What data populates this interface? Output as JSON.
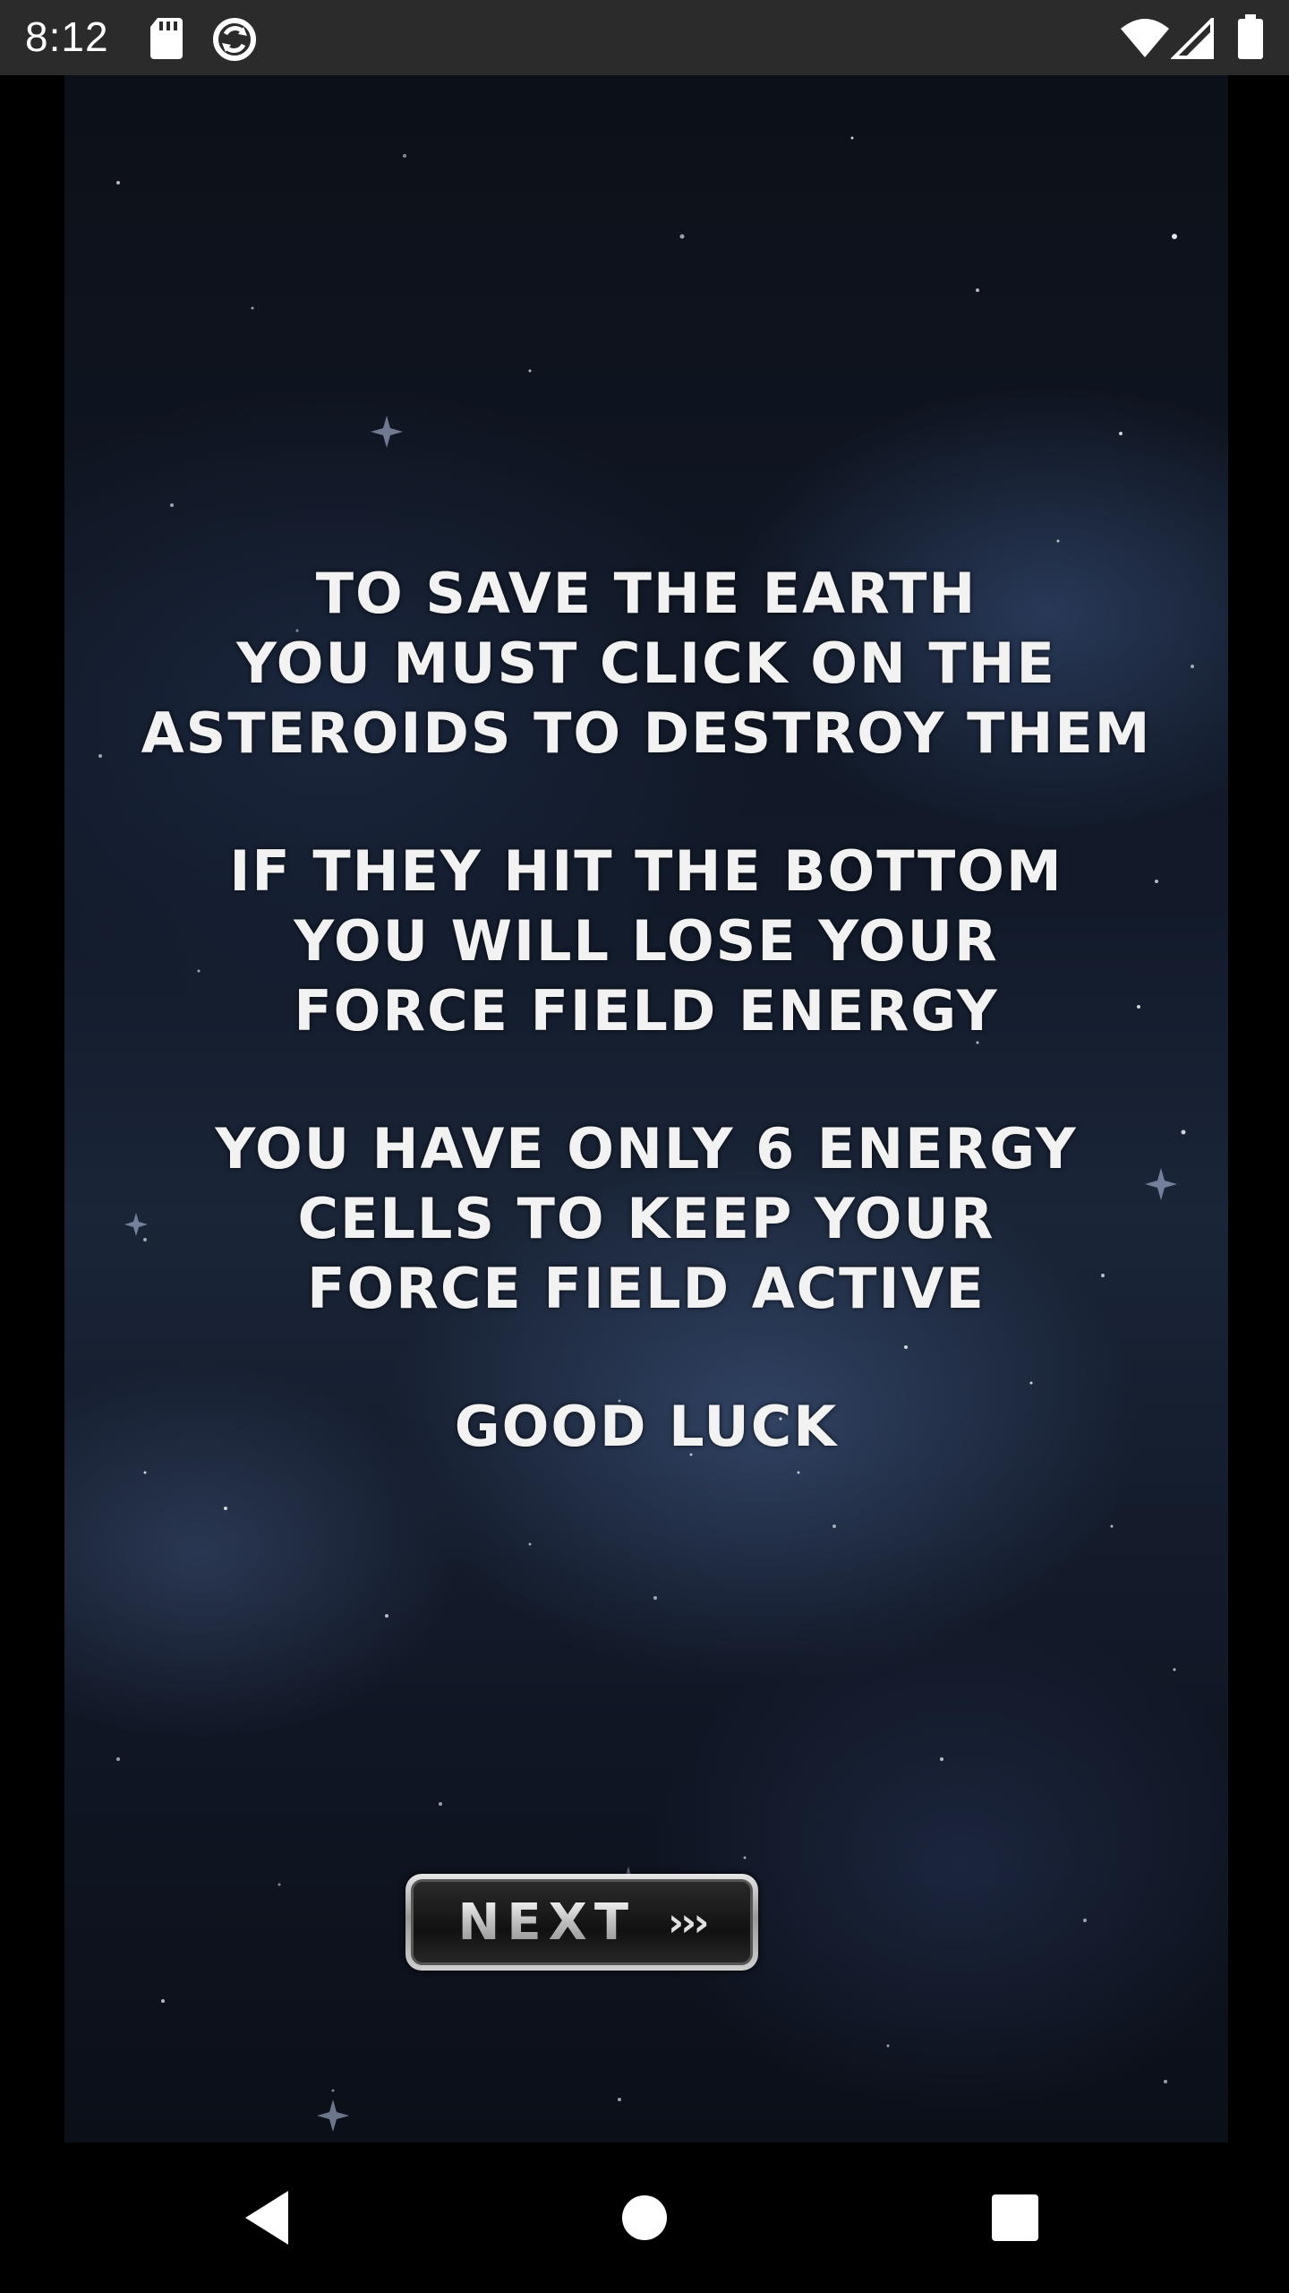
{
  "status_bar": {
    "time": "8:12",
    "icons": [
      "sd-card-icon",
      "sync-icon",
      "wifi-icon",
      "signal-icon",
      "battery-icon"
    ]
  },
  "instructions": {
    "paragraph_1": [
      "TO SAVE THE EARTH",
      "YOU MUST CLICK ON THE",
      "ASTEROIDS TO DESTROY THEM"
    ],
    "paragraph_2": [
      "IF THEY HIT THE BOTTOM",
      "YOU WILL LOSE YOUR",
      "FORCE FIELD ENERGY"
    ],
    "paragraph_3": [
      "YOU HAVE ONLY 6 ENERGY",
      "CELLS TO KEEP YOUR",
      "FORCE FIELD ACTIVE"
    ],
    "closing": "GOOD LUCK"
  },
  "next_button": {
    "label": "NEXT",
    "chevrons": "›››"
  },
  "nav_bar": {
    "buttons": [
      "back-icon",
      "home-icon",
      "recents-icon"
    ]
  },
  "colors": {
    "status_bar_bg": "#2b2b2b",
    "text": "#f2f2f2",
    "background": "#000000"
  }
}
